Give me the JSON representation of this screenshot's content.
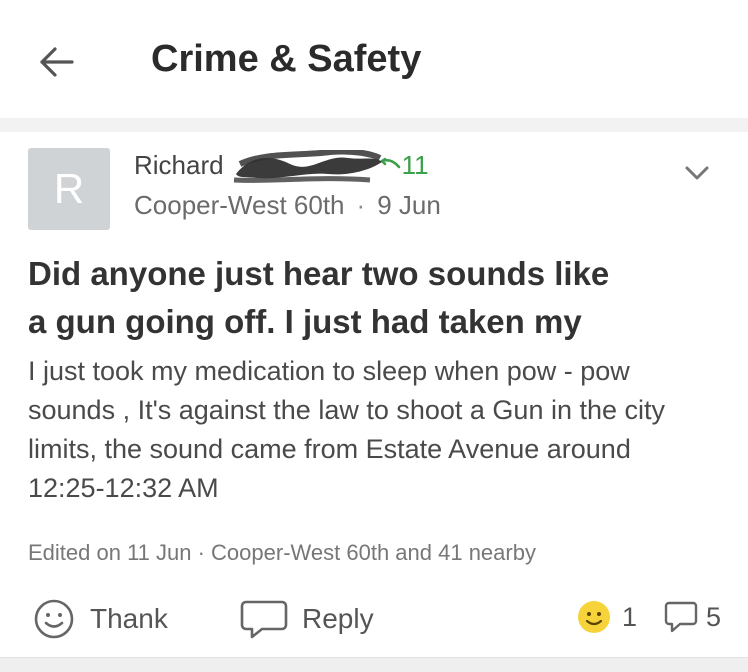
{
  "header": {
    "back_icon": "arrow-left-icon",
    "title": "Crime & Safety"
  },
  "post": {
    "avatar_letter": "R",
    "author_name": "Richard",
    "thanks_count": "11",
    "neighborhood": "Cooper-West 60th",
    "separator": "·",
    "date": "9 Jun",
    "subject_lines": [
      "Did anyone just hear two sounds like",
      "a gun going off. I just had taken my"
    ],
    "body_lines": [
      "I just took my medication to sleep when pow - pow",
      "sounds , It's against the law to shoot a Gun in the city",
      "limits, the sound came from Estate Avenue around",
      "12:25-12:32 AM"
    ],
    "edited_note": "Edited on 11 Jun · Cooper-West 60th and 41 nearby"
  },
  "actions": {
    "thank_label": "Thank",
    "reply_label": "Reply",
    "reaction_count": "1",
    "reply_count": "5"
  },
  "colors": {
    "accent_green": "#3aa04a",
    "avatar_bg": "#cfd3d6",
    "emoji_yellow": "#f7d33a"
  }
}
